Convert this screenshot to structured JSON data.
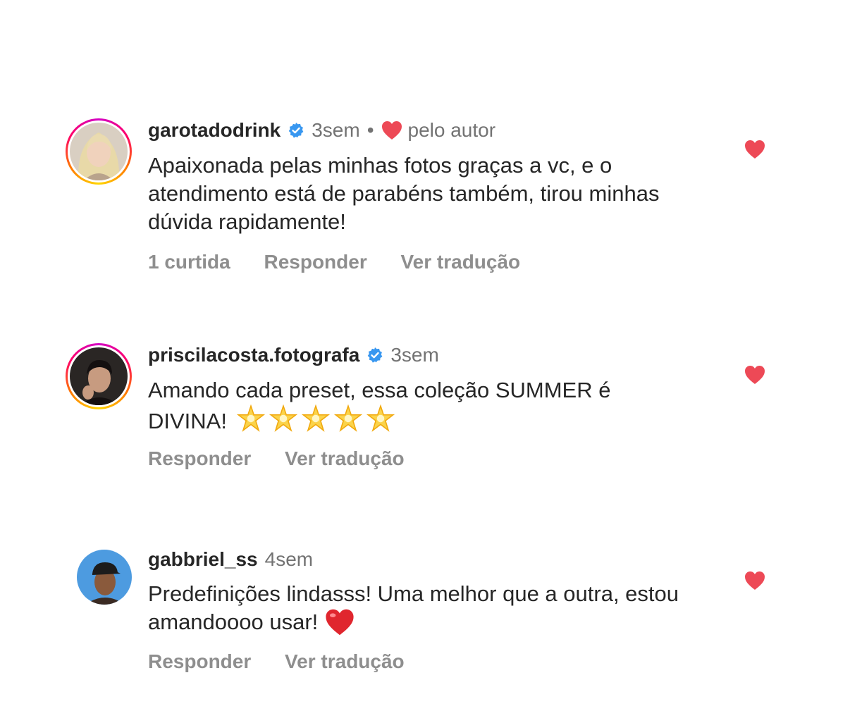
{
  "comments": [
    {
      "username": "garotadodrink",
      "verified": true,
      "time": "3sem",
      "separator": "•",
      "liked_by_author_label": "pelo autor",
      "text": "Apaixonada pelas minhas fotos graças a vc, e o atendimento está de parabéns também, tirou minhas dúvida rapidamente!",
      "likes_label": "1 curtida",
      "reply_label": "Responder",
      "translate_label": "Ver tradução",
      "avatar_icon": "profile-photo-blonde-woman",
      "story_ring": true
    },
    {
      "username": "priscilacosta.fotografa",
      "verified": true,
      "time": "3sem",
      "text": "Amando cada preset, essa coleção SUMMER é DIVINA!",
      "text_emoji": "glowing-star-x5",
      "reply_label": "Responder",
      "translate_label": "Ver tradução",
      "avatar_icon": "profile-photo-dark-hair",
      "story_ring": true
    },
    {
      "username": "gabbriel_ss",
      "verified": false,
      "time": "4sem",
      "text": "Predefinições lindasss! Uma melhor que a outra, estou amandoooo usar!",
      "text_emoji": "red-heart",
      "reply_label": "Responder",
      "translate_label": "Ver tradução",
      "avatar_icon": "profile-photo-man-with-cap",
      "story_ring": false
    }
  ],
  "colors": {
    "like_red": "#ed4956",
    "verified_blue": "#3897f0",
    "secondary_text": "#737373",
    "primary_text": "#262626"
  }
}
